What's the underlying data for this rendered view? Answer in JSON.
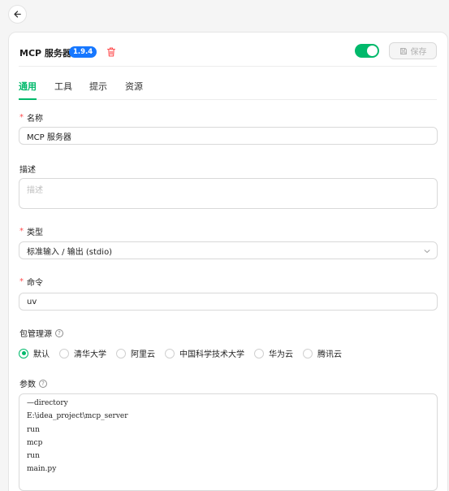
{
  "header": {
    "title": "MCP 服务器",
    "version_badge": "1.9.4",
    "save_label": "保存",
    "enabled": true
  },
  "tabs": [
    {
      "label": "通用",
      "active": true
    },
    {
      "label": "工具",
      "active": false
    },
    {
      "label": "提示",
      "active": false
    },
    {
      "label": "资源",
      "active": false
    }
  ],
  "form": {
    "name": {
      "label": "名称",
      "required": true,
      "value": "MCP 服务器"
    },
    "description": {
      "label": "描述",
      "placeholder": "描述",
      "value": ""
    },
    "type": {
      "label": "类型",
      "required": true,
      "value": "标准输入 / 输出 (stdio)"
    },
    "command": {
      "label": "命令",
      "required": true,
      "value": "uv"
    },
    "registry": {
      "label": "包管理源",
      "options": [
        "默认",
        "清华大学",
        "阿里云",
        "中国科学技术大学",
        "华为云",
        "腾讯云"
      ],
      "selected": "默认"
    },
    "args": {
      "label": "参数",
      "lines": [
        "—directory",
        "E:\\idea_project\\mcp_server",
        "run",
        "mcp",
        "run",
        "main.py"
      ]
    }
  },
  "colors": {
    "accent": "#00b96b",
    "badge": "#1677ff",
    "danger": "#ff4d4f"
  }
}
